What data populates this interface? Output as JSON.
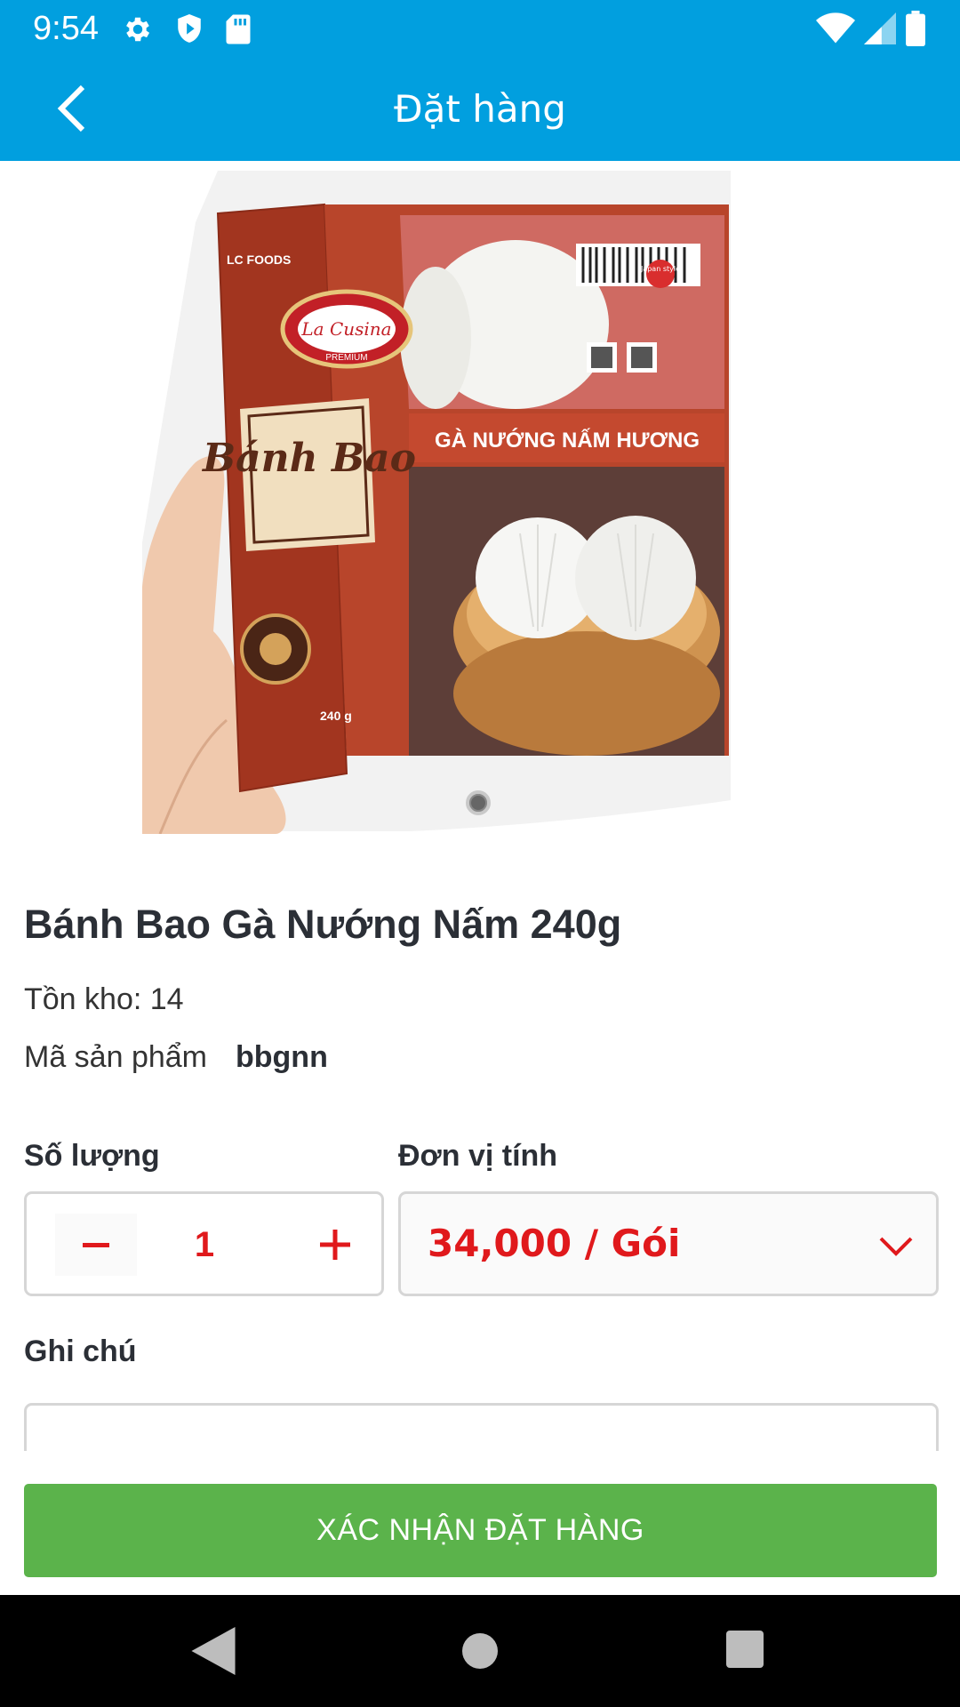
{
  "status_bar": {
    "time": "9:54",
    "left_icons": [
      "gear-icon",
      "shield-icon",
      "sd-card-icon"
    ],
    "right_icons": [
      "wifi-icon",
      "signal-icon",
      "battery-icon"
    ]
  },
  "app_bar": {
    "title": "Đặt hàng",
    "back_icon": "chevron-left-icon"
  },
  "product_image": {
    "brand": "LC FOODS",
    "logo": "La Cusina",
    "logo_sub": "PREMIUM",
    "package_title": "Bánh Bao",
    "package_flavor": "GÀ NƯỚNG NẤM HƯƠNG",
    "weight": "240 g",
    "badge_japan": "Japan style",
    "carousel_index": 1,
    "carousel_count": 1
  },
  "product": {
    "name": "Bánh Bao Gà Nướng Nấm 240g",
    "stock_text": "Tồn kho: 14",
    "code_label": "Mã sản phẩm",
    "code_value": "bbgnn"
  },
  "order_form": {
    "quantity_label": "Số lượng",
    "quantity_value": "1",
    "minus_label": "−",
    "plus_label": "+",
    "unit_label": "Đơn vị tính",
    "unit_value": "34,000 / Gói",
    "note_label": "Ghi chú",
    "note_value": ""
  },
  "actions": {
    "confirm_label": "XÁC NHẬN ĐẶT HÀNG"
  },
  "colors": {
    "primary": "#019fdf",
    "accent_red": "#e0191c",
    "confirm_green": "#5bb34b"
  }
}
